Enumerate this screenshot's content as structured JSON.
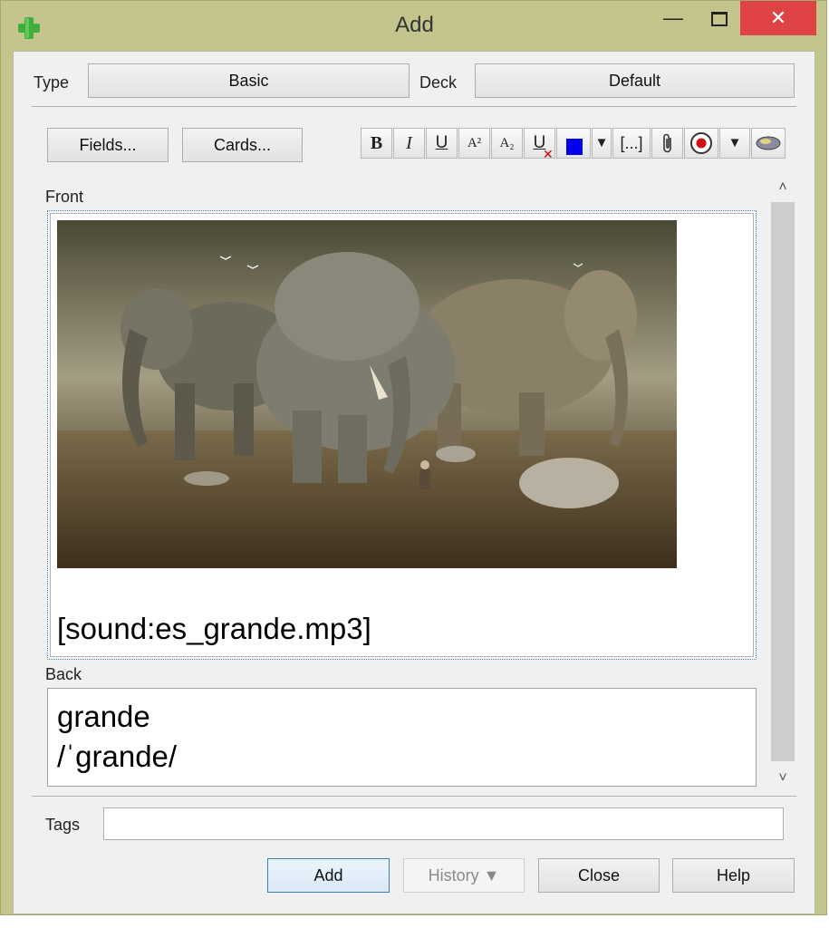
{
  "window": {
    "title": "Add",
    "minimize_glyph": "—",
    "close_glyph": "✕"
  },
  "top": {
    "type_label": "Type",
    "type_value": "Basic",
    "deck_label": "Deck",
    "deck_value": "Default"
  },
  "toolbar": {
    "fields_label": "Fields...",
    "cards_label": "Cards...",
    "bold": "B",
    "italic": "I",
    "underline": "U",
    "superscript": "A²",
    "subscript": "A₂",
    "clear_format": "U",
    "dropdown_arrow": "▼",
    "cloze": "[...]",
    "attach": "📎",
    "record_arrow": "▼",
    "text_color": "#0000ee"
  },
  "editor": {
    "front_label": "Front",
    "front_sound": "[sound:es_grande.mp3]",
    "back_label": "Back",
    "back_line1": "grande",
    "back_line2": "/ˈgrande/"
  },
  "scroll": {
    "up": "˄",
    "down": "˅"
  },
  "tags": {
    "label": "Tags",
    "value": ""
  },
  "footer": {
    "add_label": "Add",
    "history_label": "History ▼",
    "close_label": "Close",
    "help_label": "Help"
  }
}
